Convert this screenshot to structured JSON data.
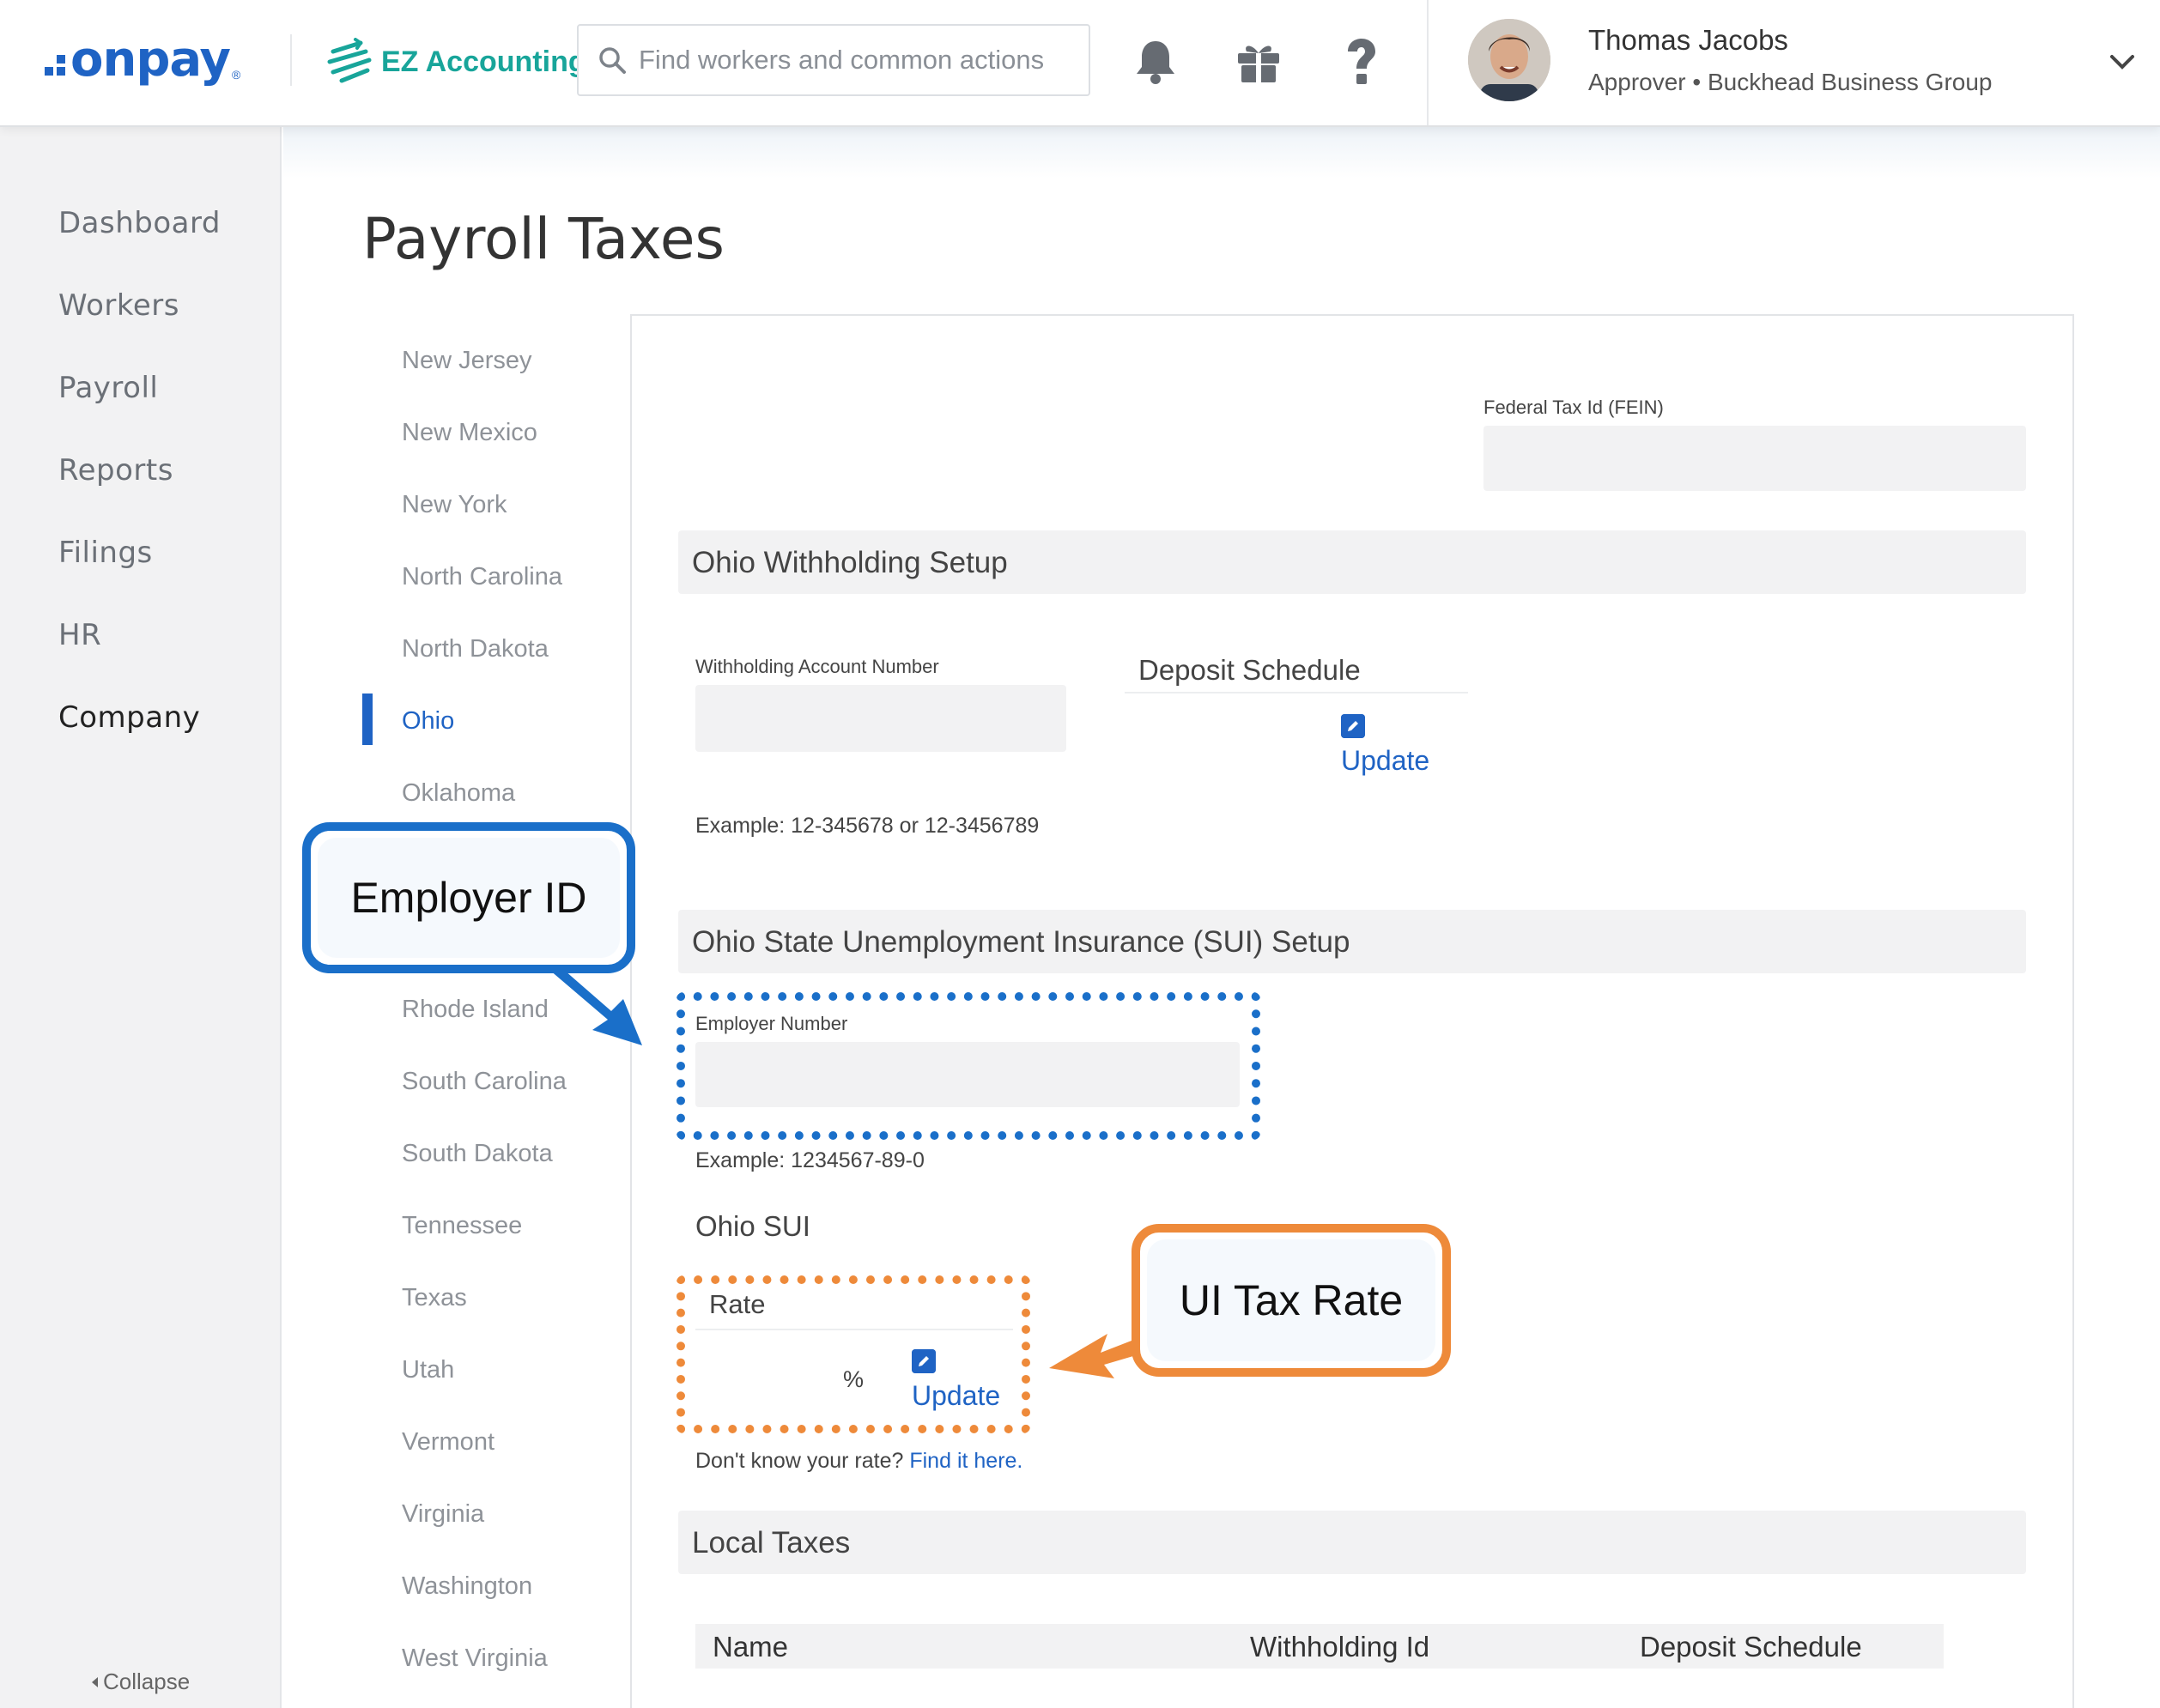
{
  "header": {
    "logo_text": "onpay",
    "logo_reg": "®",
    "ez_label": "EZ Accounting",
    "search_placeholder": "Find workers and common actions",
    "icons": [
      "bell-icon",
      "gift-icon",
      "help-icon",
      "chevron-down-icon"
    ],
    "user": {
      "name": "Thomas Jacobs",
      "role": "Approver • Buckhead Business Group"
    }
  },
  "sidebar": {
    "items": [
      {
        "label": "Dashboard"
      },
      {
        "label": "Workers"
      },
      {
        "label": "Payroll"
      },
      {
        "label": "Reports"
      },
      {
        "label": "Filings"
      },
      {
        "label": "HR"
      },
      {
        "label": "Company"
      }
    ],
    "active": "Company",
    "collapse_label": "Collapse"
  },
  "page": {
    "title": "Payroll Taxes"
  },
  "states": {
    "items": [
      "New Jersey",
      "New Mexico",
      "New York",
      "North Carolina",
      "North Dakota",
      "Ohio",
      "Oklahoma",
      "Rhode Island",
      "South Carolina",
      "South Dakota",
      "Tennessee",
      "Texas",
      "Utah",
      "Vermont",
      "Virginia",
      "Washington",
      "West Virginia"
    ],
    "active": "Ohio"
  },
  "panel": {
    "fein_label": "Federal Tax Id (FEIN)",
    "fein_value": "",
    "withholding": {
      "title": "Ohio Withholding Setup",
      "account_label": "Withholding Account Number",
      "account_value": "",
      "deposit_schedule_label": "Deposit Schedule",
      "update_label": "Update",
      "example": "Example: 12-345678 or 12-3456789"
    },
    "sui": {
      "title": "Ohio State Unemployment Insurance (SUI) Setup",
      "employer_number_label": "Employer Number",
      "employer_number_value": "",
      "example": "Example: 1234567-89-0",
      "sub_title": "Ohio SUI",
      "rate_label": "Rate",
      "rate_unit": "%",
      "update_label": "Update",
      "help_text": "Don't know your rate?",
      "help_link": "Find it here."
    },
    "local_taxes": {
      "title": "Local Taxes",
      "columns": [
        "Name",
        "Withholding Id",
        "Deposit Schedule"
      ]
    }
  },
  "callouts": {
    "employer_id": "Employer ID",
    "ui_tax_rate": "UI Tax Rate"
  },
  "colors": {
    "brand_blue": "#1f63c4",
    "ez_teal": "#18a59a",
    "callout_blue": "#1a6fc9",
    "callout_orange": "#ee8a3a"
  }
}
